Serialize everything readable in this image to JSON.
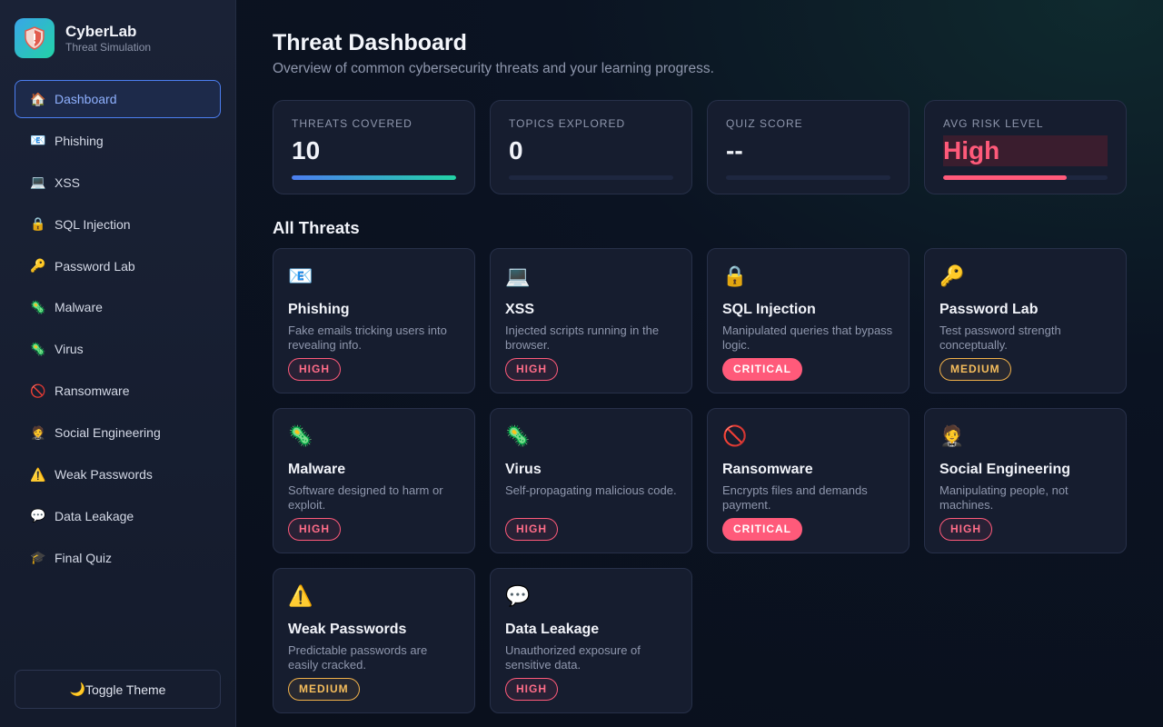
{
  "brand": {
    "name": "CyberLab",
    "subtitle": "Threat Simulation"
  },
  "nav": [
    {
      "label": "Dashboard",
      "icon": "house-icon",
      "active": true
    },
    {
      "label": "Phishing",
      "icon": "envelope-icon"
    },
    {
      "label": "XSS",
      "icon": "laptop-icon"
    },
    {
      "label": "SQL Injection",
      "icon": "lock-icon"
    },
    {
      "label": "Password Lab",
      "icon": "key-icon"
    },
    {
      "label": "Malware",
      "icon": "microbe-icon"
    },
    {
      "label": "Virus",
      "icon": "microbe-icon"
    },
    {
      "label": "Ransomware",
      "icon": "no-entry-icon"
    },
    {
      "label": "Social Engineering",
      "icon": "person-icon"
    },
    {
      "label": "Weak Passwords",
      "icon": "warning-icon"
    },
    {
      "label": "Data Leakage",
      "icon": "speech-bubble-icon"
    },
    {
      "label": "Final Quiz",
      "icon": "graduation-cap-icon"
    }
  ],
  "toggle_theme": {
    "label": "Toggle Theme",
    "icon": "moon-icon"
  },
  "header": {
    "title": "Threat Dashboard",
    "subtitle": "Overview of common cybersecurity threats and your learning progress."
  },
  "stats": [
    {
      "label": "THREATS COVERED",
      "value": "10",
      "progress": 1.0,
      "fill": "gradient"
    },
    {
      "label": "TOPICS EXPLORED",
      "value": "0",
      "progress": 0.0,
      "fill": "none"
    },
    {
      "label": "QUIZ SCORE",
      "value": "--",
      "progress": 0.0,
      "fill": "none"
    },
    {
      "label": "AVG RISK LEVEL",
      "value": "High",
      "progress": 0.75,
      "fill": "#ff5a7a"
    }
  ],
  "section": {
    "title": "All Threats"
  },
  "threats": [
    {
      "title": "Phishing",
      "desc": "Fake emails tricking users into revealing info.",
      "level": "HIGH",
      "icon": "envelope-icon"
    },
    {
      "title": "XSS",
      "desc": "Injected scripts running in the browser.",
      "level": "HIGH",
      "icon": "laptop-icon"
    },
    {
      "title": "SQL Injection",
      "desc": "Manipulated queries that bypass logic.",
      "level": "CRITICAL",
      "icon": "lock-icon"
    },
    {
      "title": "Password Lab",
      "desc": "Test password strength conceptually.",
      "level": "MEDIUM",
      "icon": "key-icon"
    },
    {
      "title": "Malware",
      "desc": "Software designed to harm or exploit.",
      "level": "HIGH",
      "icon": "microbe-icon"
    },
    {
      "title": "Virus",
      "desc": "Self-propagating malicious code.",
      "level": "HIGH",
      "icon": "microbe-icon"
    },
    {
      "title": "Ransomware",
      "desc": "Encrypts files and demands payment.",
      "level": "CRITICAL",
      "icon": "no-entry-icon"
    },
    {
      "title": "Social Engineering",
      "desc": "Manipulating people, not machines.",
      "level": "HIGH",
      "icon": "person-icon"
    },
    {
      "title": "Weak Passwords",
      "desc": "Predictable passwords are easily cracked.",
      "level": "MEDIUM",
      "icon": "warning-icon"
    },
    {
      "title": "Data Leakage",
      "desc": "Unauthorized exposure of sensitive data.",
      "level": "HIGH",
      "icon": "speech-bubble-icon"
    }
  ],
  "colors": {
    "accent": "#4c7ef0",
    "high": "#ff5a7a",
    "critical": "#ff5a7a",
    "medium": "#f1b14a",
    "teal": "#22d3a6"
  }
}
